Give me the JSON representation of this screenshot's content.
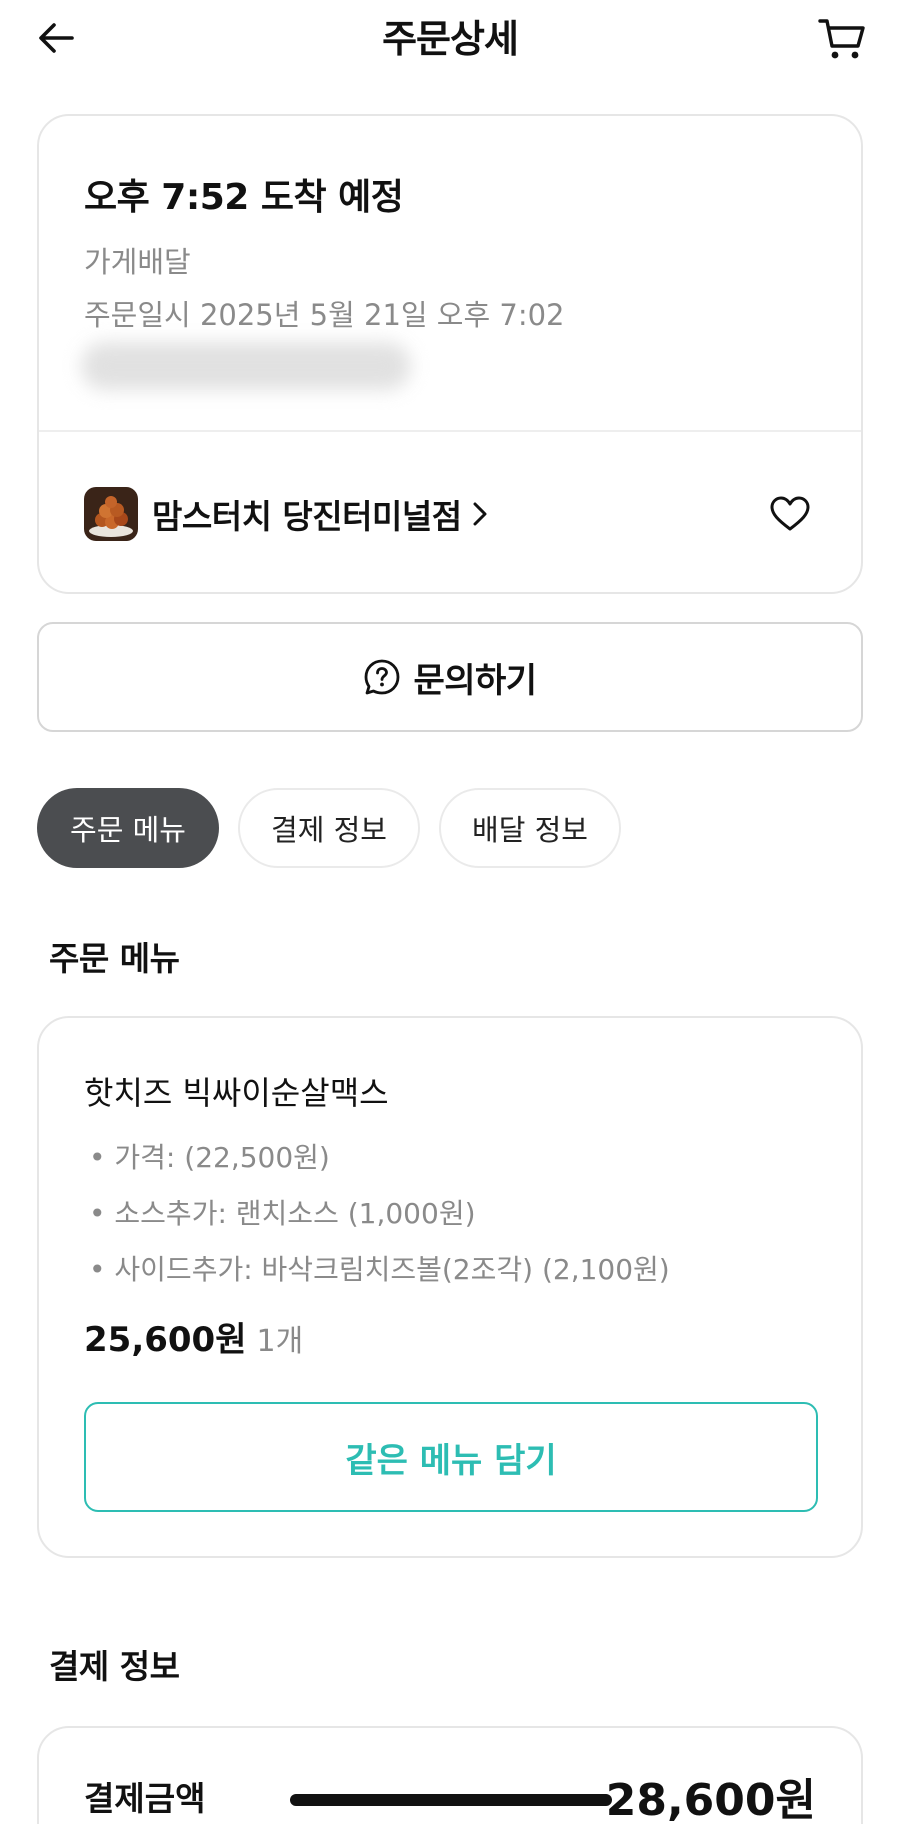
{
  "header": {
    "title": "주문상세",
    "back_icon": "arrow-left-icon",
    "cart_icon": "cart-icon"
  },
  "order": {
    "arrival": "오후 7:52 도착 예정",
    "delivery_type": "가게배달",
    "order_date": "주문일시 2025년 5월 21일 오후 7:02"
  },
  "store": {
    "name": "맘스터치 당진터미널점",
    "thumb_icon": "store-food-thumbnail",
    "favorite_icon": "heart-icon"
  },
  "inquiry": {
    "label": "문의하기",
    "icon": "question-chat-icon"
  },
  "tabs": [
    {
      "label": "주문 메뉴",
      "active": true
    },
    {
      "label": "결제 정보",
      "active": false
    },
    {
      "label": "배달 정보",
      "active": false
    }
  ],
  "menu_section": {
    "title": "주문 메뉴",
    "item": {
      "name": "핫치즈 빅싸이순살맥스",
      "options": [
        "• 가격: (22,500원)",
        "• 소스추가: 랜치소스 (1,000원)",
        "• 사이드추가: 바삭크림치즈볼(2조각) (2,100원)"
      ],
      "price": "25,600원",
      "quantity": "1개"
    },
    "add_same_label": "같은 메뉴 담기"
  },
  "payment_section": {
    "title": "결제 정보",
    "label": "결제금액",
    "amount": "28,600원"
  },
  "colors": {
    "accent": "#2dbdb3",
    "active_tab": "#4b4d50",
    "muted_text": "#8a8a8a"
  }
}
